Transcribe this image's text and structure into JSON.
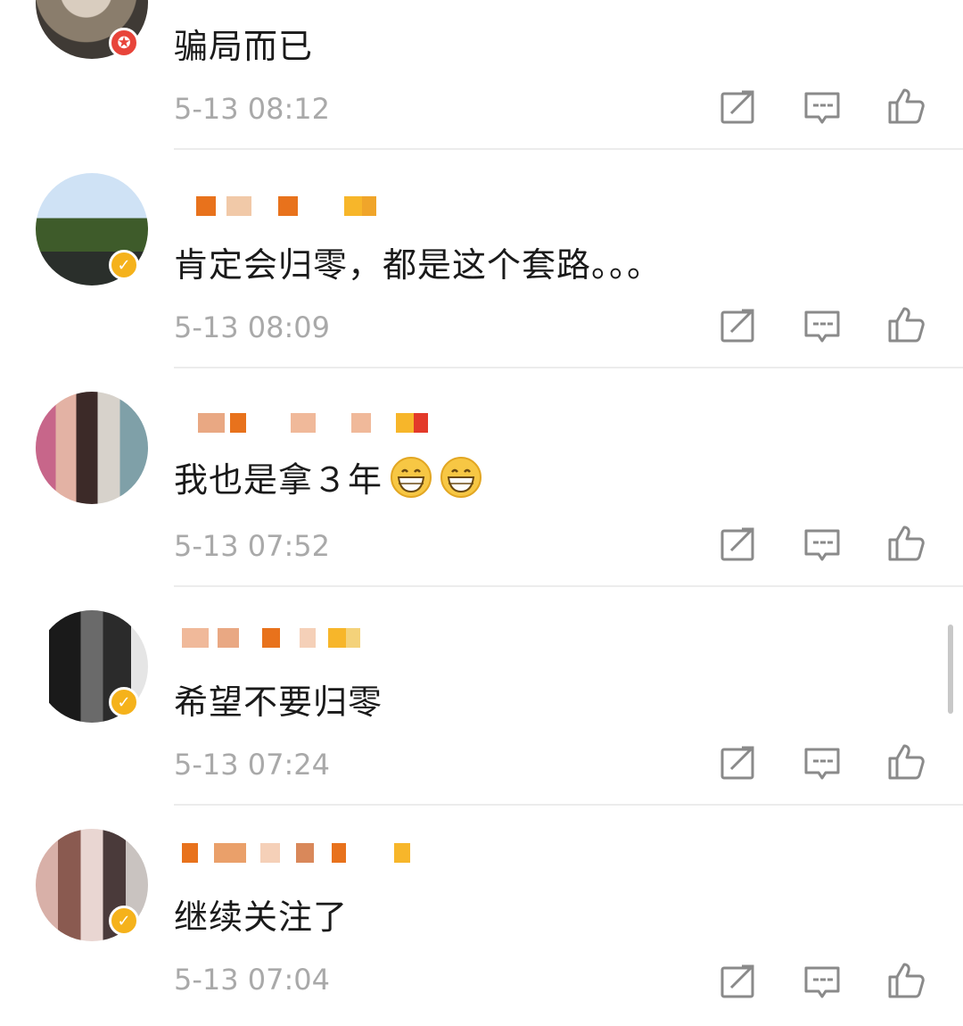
{
  "comments": [
    {
      "text": "骗局而已",
      "time": "5-13 08:12",
      "badge": "red",
      "emoji_count": 0
    },
    {
      "text": "肯定会归零，都是这个套路。。。",
      "time": "5-13 08:09",
      "badge": "gold",
      "emoji_count": 0
    },
    {
      "text": "我也是拿３年",
      "time": "5-13 07:52",
      "badge": "none",
      "emoji_count": 2
    },
    {
      "text": "希望不要归零",
      "time": "5-13 07:24",
      "badge": "gold",
      "emoji_count": 0
    },
    {
      "text": "继续关注了",
      "time": "5-13 07:04",
      "badge": "gold",
      "emoji_count": 0
    }
  ],
  "icons": {
    "repost": "repost-icon",
    "reply": "comment-icon",
    "like": "thumbs-up-icon",
    "grin": "grinning-emoji"
  },
  "colors": {
    "text": "#1a1a1a",
    "time": "#a9a9a9",
    "icon": "#8a8a8a",
    "badge_gold": "#f5b21b",
    "badge_red": "#e8443a"
  }
}
